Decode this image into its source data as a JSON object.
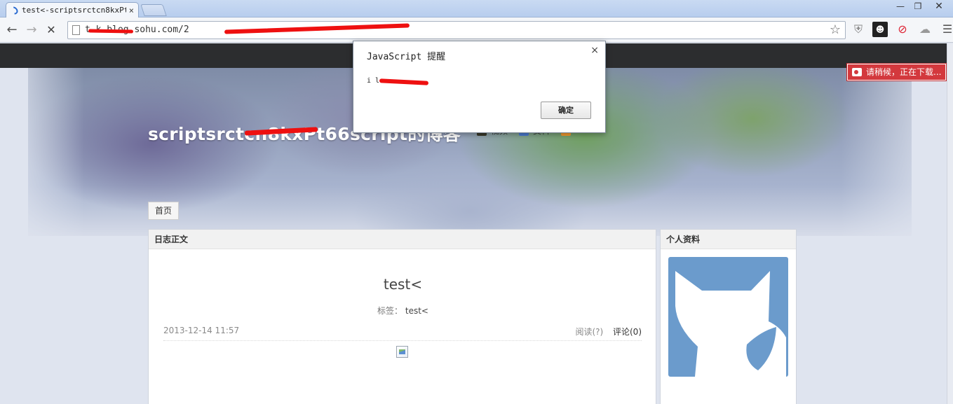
{
  "browser": {
    "tab_title": "test<-scriptsrctcn8kxPt",
    "tab_close": "×",
    "url": "t         k.blog.sohu.com/2",
    "window_controls": {
      "minimize": "—",
      "maximize": "❐",
      "close": "✕"
    },
    "icons": [
      "back-icon",
      "forward-icon",
      "stop-icon",
      "page-icon",
      "star-icon",
      "shield-icon",
      "mask-icon",
      "block-icon",
      "cloud-icon",
      "menu-icon"
    ]
  },
  "page": {
    "blog_title": "scriptsrctcn8kxPt66script的博客",
    "nav_links": [
      "视频",
      "资料"
    ],
    "home_button": "首页",
    "main_column_header": "日志正文",
    "post_title": "test<",
    "tags_label": "标签：",
    "tags_value": "test<",
    "post_date": "2013-12-14 11:57",
    "read_link": "阅读(?)",
    "comment_link": "评论(0)",
    "side_column_header": "个人资料",
    "download_badge": "请稍候，正在下载..."
  },
  "dialog": {
    "title": "JavaScript 提醒",
    "message": "i l",
    "ok_button": "确定",
    "close": "×"
  },
  "colors": {
    "redaction": "#ee1010",
    "avatar_bg": "#6b9bcc",
    "topbar": "#2c2d2f",
    "download_badge": "#d3383d"
  }
}
